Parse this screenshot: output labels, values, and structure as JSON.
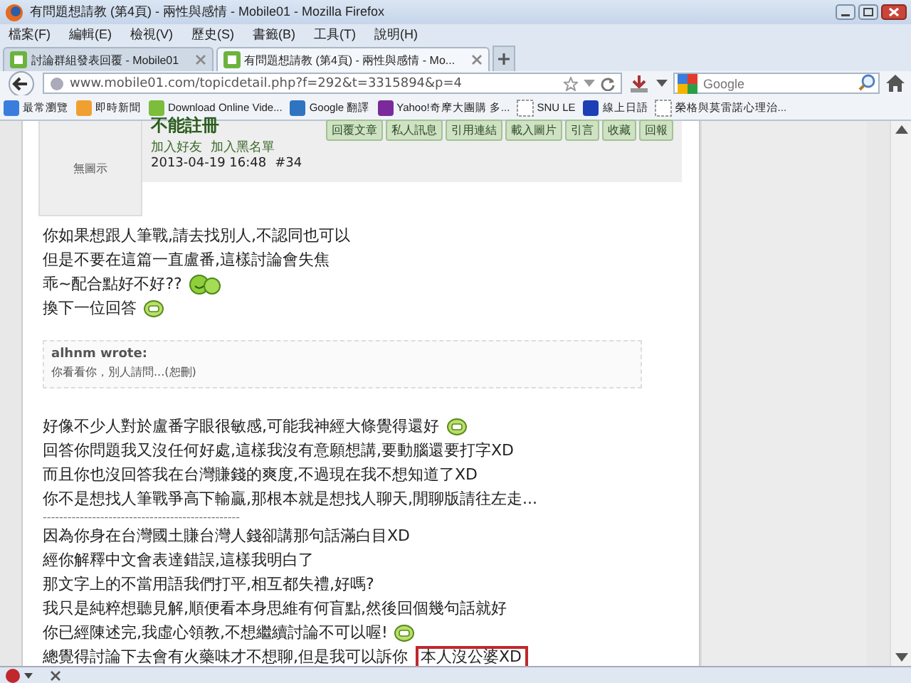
{
  "window": {
    "title": "有問題想請教 (第4頁) - 兩性與感情 - Mobile01 - Mozilla Firefox"
  },
  "menu": [
    "檔案(F)",
    "編輯(E)",
    "檢視(V)",
    "歷史(S)",
    "書籤(B)",
    "工具(T)",
    "說明(H)"
  ],
  "tabs": [
    {
      "label": "討論群組發表回覆 - Mobile01",
      "selected": false
    },
    {
      "label": "有問題想請教 (第4頁) - 兩性與感情 - Mo...",
      "selected": true
    }
  ],
  "address": {
    "url": "www.mobile01.com/topicdetail.php?f=292&t=3315894&p=4"
  },
  "search": {
    "placeholder": "Google"
  },
  "bookmarks": [
    "最常瀏覽",
    "即時新聞",
    "Download Online Vide...",
    "Google 翻譯",
    "Yahoo!奇摩大團購 多...",
    "SNU LE",
    "線上日語",
    "榮格與莫雷諾心理治..."
  ],
  "post": {
    "avatar_text": "無圖示",
    "username": "不能註冊",
    "links": [
      "加入好友",
      "加入黑名單"
    ],
    "date": "2013-04-19 16:48",
    "floor": "#34",
    "buttons": [
      "回覆文章",
      "私人訊息",
      "引用連結",
      "載入圖片",
      "引言",
      "收藏",
      "回報"
    ]
  },
  "body": [
    {
      "kind": "line",
      "parts": [
        {
          "kind": "text",
          "text": "你如果想跟人筆戰,請去找別人,不認同也可以"
        }
      ]
    },
    {
      "kind": "line",
      "parts": [
        {
          "kind": "text",
          "text": "但是不要在這篇一直盧番,這樣討論會失焦"
        }
      ]
    },
    {
      "kind": "line",
      "parts": [
        {
          "kind": "text",
          "text": "乖~配合點好不好??"
        },
        {
          "kind": "smiley_pair"
        }
      ]
    },
    {
      "kind": "line",
      "parts": [
        {
          "kind": "text",
          "text": "換下一位回答"
        },
        {
          "kind": "grin"
        }
      ]
    },
    {
      "kind": "quote",
      "author": "alhnm wrote:",
      "text": "你看看你，別人請問...(恕刪)"
    },
    {
      "kind": "line",
      "parts": [
        {
          "kind": "text",
          "text": "好像不少人對於盧番字眼很敏感,可能我神經大條覺得還好"
        },
        {
          "kind": "grin"
        }
      ]
    },
    {
      "kind": "line",
      "parts": [
        {
          "kind": "text",
          "text": "回答你問題我又沒任何好處,這樣我沒有意願想講,要動腦還要打字XD"
        }
      ]
    },
    {
      "kind": "line",
      "parts": [
        {
          "kind": "text",
          "text": "而且你也沒回答我在台灣賺錢的爽度,不過現在我不想知道了XD"
        }
      ]
    },
    {
      "kind": "line",
      "parts": [
        {
          "kind": "text",
          "text": "你不是想找人筆戰爭高下輸贏,那根本就是想找人聊天,閒聊版請往左走..."
        }
      ]
    },
    {
      "kind": "separator",
      "text": "------------------------------------------------"
    },
    {
      "kind": "line",
      "parts": [
        {
          "kind": "text",
          "text": "因為你身在台灣國土賺台灣人錢卻講那句話滿白目XD"
        }
      ]
    },
    {
      "kind": "line",
      "parts": [
        {
          "kind": "text",
          "text": "經你解釋中文會表達錯誤,這樣我明白了"
        }
      ]
    },
    {
      "kind": "line",
      "parts": [
        {
          "kind": "text",
          "text": "那文字上的不當用語我們打平,相互都失禮,好嗎?"
        }
      ]
    },
    {
      "kind": "line",
      "parts": [
        {
          "kind": "text",
          "text": "我只是純粹想聽見解,順便看本身思維有何盲點,然後回個幾句話就好"
        }
      ]
    },
    {
      "kind": "line",
      "parts": [
        {
          "kind": "text",
          "text": "你已經陳述完,我虛心領教,不想繼續討論不可以喔!"
        },
        {
          "kind": "grin"
        }
      ]
    },
    {
      "kind": "line",
      "parts": [
        {
          "kind": "text",
          "text": "總覺得討論下去會有火藥味才不想聊,但是我可以訴你"
        },
        {
          "kind": "boxed",
          "text": "本人沒公婆XD"
        }
      ]
    }
  ]
}
